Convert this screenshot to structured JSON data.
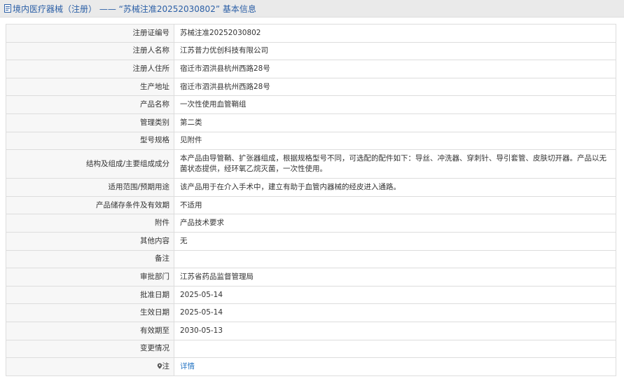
{
  "header": {
    "title": "境内医疗器械（注册） —— “苏械注准20252030802” 基本信息",
    "icon": "document-icon"
  },
  "fields": [
    {
      "label": "注册证编号",
      "value": "苏械注准20252030802"
    },
    {
      "label": "注册人名称",
      "value": "江苏普力优创科技有限公司"
    },
    {
      "label": "注册人住所",
      "value": "宿迁市泗洪县杭州西路28号"
    },
    {
      "label": "生产地址",
      "value": "宿迁市泗洪县杭州西路28号"
    },
    {
      "label": "产品名称",
      "value": "一次性使用血管鞘组"
    },
    {
      "label": "管理类别",
      "value": "第二类"
    },
    {
      "label": "型号规格",
      "value": "见附件"
    },
    {
      "label": "结构及组成/主要组成成分",
      "value": "本产品由导管鞘、扩张器组成，根据规格型号不同，可选配的配件如下：导丝、冲洗器、穿刺针、导引套管、皮肤切开器。产品以无菌状态提供，经环氧乙烷灭菌，一次性使用。"
    },
    {
      "label": "适用范围/预期用途",
      "value": "该产品用于在介入手术中，建立有助于血管内器械的经皮进入通路。"
    },
    {
      "label": "产品储存条件及有效期",
      "value": "不适用"
    },
    {
      "label": "附件",
      "value": "产品技术要求"
    },
    {
      "label": "其他内容",
      "value": "无"
    },
    {
      "label": "备注",
      "value": ""
    },
    {
      "label": "审批部门",
      "value": "江苏省药品监督管理局"
    },
    {
      "label": "批准日期",
      "value": "2025-05-14"
    },
    {
      "label": "生效日期",
      "value": "2025-05-14"
    },
    {
      "label": "有效期至",
      "value": "2030-05-13"
    },
    {
      "label": "变更情况",
      "value": ""
    }
  ],
  "note_row": {
    "label": "注",
    "icon": "pin-icon",
    "link_text": "详情"
  },
  "colors": {
    "title": "#2b5fa6",
    "link": "#2b78c5",
    "label_bg": "#f7f7f7",
    "header_bg": "#eaeaea",
    "border": "#dddddd"
  }
}
